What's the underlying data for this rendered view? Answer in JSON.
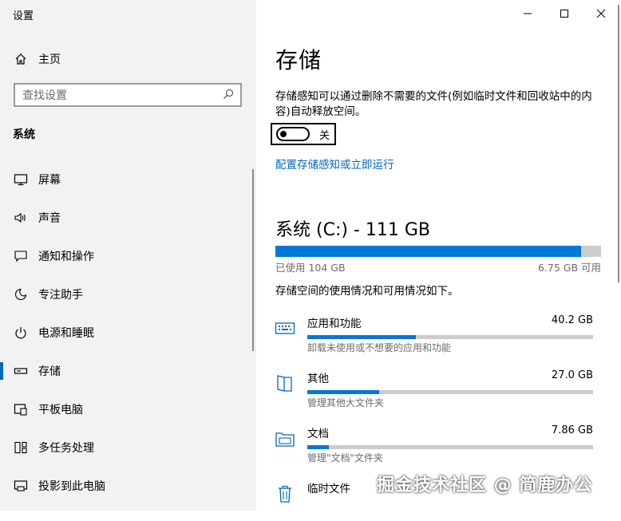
{
  "window": {
    "title": "设置"
  },
  "sidebar": {
    "home_label": "主页",
    "search_placeholder": "查找设置",
    "section_label": "系统",
    "items": [
      {
        "label": "屏幕",
        "icon": "monitor-icon"
      },
      {
        "label": "声音",
        "icon": "speaker-icon"
      },
      {
        "label": "通知和操作",
        "icon": "notification-icon"
      },
      {
        "label": "专注助手",
        "icon": "moon-icon"
      },
      {
        "label": "电源和睡眠",
        "icon": "power-icon"
      },
      {
        "label": "存储",
        "icon": "storage-icon",
        "selected": true
      },
      {
        "label": "平板电脑",
        "icon": "tablet-icon"
      },
      {
        "label": "多任务处理",
        "icon": "multitask-icon"
      },
      {
        "label": "投影到此电脑",
        "icon": "project-icon"
      }
    ]
  },
  "main": {
    "title": "存储",
    "description": "存储感知可以通过删除不需要的文件(例如临时文件和回收站中的内容)自动释放空间。",
    "toggle_state": "关",
    "configure_link": "配置存储感知或立即运行",
    "drive": {
      "title": "系统 (C:) - 111 GB",
      "used_text": "已使用 104 GB",
      "free_text": "6.75 GB 可用",
      "used_fraction": 0.939
    },
    "usage_note": "存储空间的使用情况和可用情况如下。",
    "categories": [
      {
        "name": "应用和功能",
        "size": "40.2 GB",
        "sub": "卸载未使用或不想要的应用和功能",
        "fraction": 0.38,
        "icon": "keyboard-icon"
      },
      {
        "name": "其他",
        "size": "27.0 GB",
        "sub": "管理其他大文件夹",
        "fraction": 0.25,
        "icon": "folder-other-icon"
      },
      {
        "name": "文档",
        "size": "7.86 GB",
        "sub": "管理\"文档\"文件夹",
        "fraction": 0.075,
        "icon": "documents-folder-icon"
      },
      {
        "name": "临时文件",
        "size": "",
        "sub": "",
        "fraction": 0.0,
        "icon": "trash-icon"
      }
    ]
  },
  "watermark": "掘金技术社区 @ 简鹿办公",
  "colors": {
    "accent": "#0067c0",
    "bar_fill": "#0078d7",
    "bar_track": "#cccccc",
    "sidebar_bg": "#f2f2f2"
  }
}
